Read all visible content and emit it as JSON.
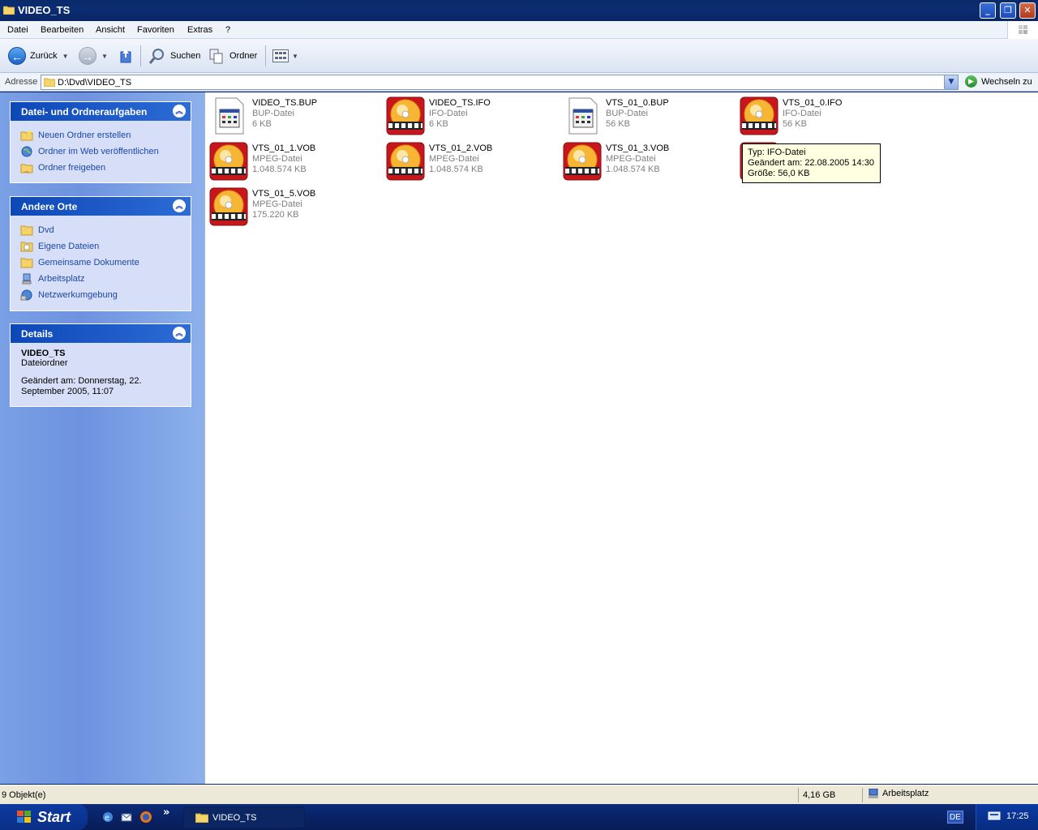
{
  "window": {
    "title": "VIDEO_TS"
  },
  "menubar": {
    "items": [
      "Datei",
      "Bearbeiten",
      "Ansicht",
      "Favoriten",
      "Extras",
      "?"
    ]
  },
  "toolbar": {
    "back_label": "Zurück",
    "search_label": "Suchen",
    "folders_label": "Ordner"
  },
  "addressbar": {
    "label": "Adresse",
    "path": "D:\\Dvd\\VIDEO_TS",
    "go_label": "Wechseln zu"
  },
  "left_pane": {
    "tasks": {
      "title": "Datei- und Ordneraufgaben",
      "items": [
        "Neuen Ordner erstellen",
        "Ordner im Web veröffentlichen",
        "Ordner freigeben"
      ]
    },
    "places": {
      "title": "Andere Orte",
      "items": [
        "Dvd",
        "Eigene Dateien",
        "Gemeinsame Dokumente",
        "Arbeitsplatz",
        "Netzwerkumgebung"
      ]
    },
    "details": {
      "title": "Details",
      "name": "VIDEO_TS",
      "type": "Dateiordner",
      "modified": "Geändert am: Donnerstag, 22. September 2005, 11:07"
    }
  },
  "files": [
    {
      "name": "VIDEO_TS.BUP",
      "type": "BUP-Datei",
      "size": "6 KB",
      "icon": "document-icon"
    },
    {
      "name": "VIDEO_TS.IFO",
      "type": "IFO-Datei",
      "size": "6 KB",
      "icon": "dvd-media-icon"
    },
    {
      "name": "VTS_01_0.BUP",
      "type": "BUP-Datei",
      "size": "56 KB",
      "icon": "document-icon"
    },
    {
      "name": "VTS_01_0.IFO",
      "type": "IFO-Datei",
      "size": "56 KB",
      "icon": "dvd-media-icon"
    },
    {
      "name": "VTS_01_1.VOB",
      "type": "MPEG-Datei",
      "size": "1.048.574 KB",
      "icon": "dvd-media-icon"
    },
    {
      "name": "VTS_01_2.VOB",
      "type": "MPEG-Datei",
      "size": "1.048.574 KB",
      "icon": "dvd-media-icon"
    },
    {
      "name": "VTS_01_3.VOB",
      "type": "MPEG-Datei",
      "size": "1.048.574 KB",
      "icon": "dvd-media-icon"
    },
    {
      "name": "",
      "type": "",
      "size": "",
      "icon": "dvd-media-icon"
    },
    {
      "name": "VTS_01_5.VOB",
      "type": "MPEG-Datei",
      "size": "175.220 KB",
      "icon": "dvd-media-icon"
    }
  ],
  "tooltip": {
    "line1": "Typ: IFO-Datei",
    "line2": "Geändert am: 22.08.2005 14:30",
    "line3": "Größe: 56,0 KB"
  },
  "statusbar": {
    "objects": "9 Objekt(e)",
    "size": "4,16 GB",
    "zone": "Arbeitsplatz"
  },
  "taskbar": {
    "start_label": "Start",
    "task_label": "VIDEO_TS",
    "lang": "DE",
    "clock": "17:25"
  },
  "colors": {
    "link": "#1c47a9",
    "panel_header": "#0c48b7",
    "taskbar": "#0a2366"
  }
}
